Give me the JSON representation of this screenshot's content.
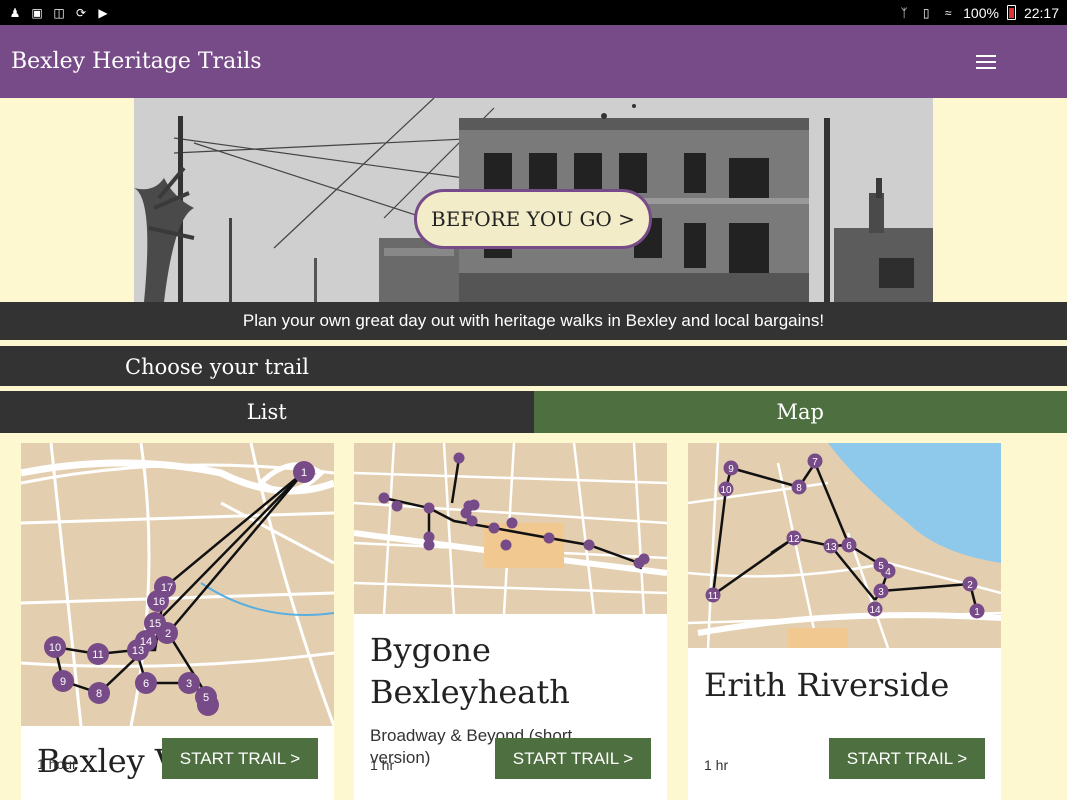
{
  "statusbar": {
    "battery": "100%",
    "time": "22:17",
    "left_icons": [
      "person-icon",
      "image-icon",
      "sd-card-icon",
      "sync-icon",
      "play-store-icon"
    ],
    "right_icons": [
      "bluetooth-icon",
      "vibrate-icon",
      "wifi-icon",
      "battery-icon"
    ]
  },
  "appbar": {
    "title": "Bexley Heritage Trails",
    "menu_icon": "hamburger-menu-icon"
  },
  "hero": {
    "button_label": "BEFORE YOU GO >"
  },
  "tagline": "Plan your own great day out with heritage walks in Bexley and local bargains!",
  "section": {
    "title": "Choose your trail"
  },
  "tabs": [
    {
      "label": "List"
    },
    {
      "label": "Map"
    }
  ],
  "trails": [
    {
      "title": "Bexley Village",
      "subtitle": "",
      "duration": "1 hour",
      "button": "START TRAIL >"
    },
    {
      "title": "Bygone Bexleyheath",
      "subtitle": "Broadway & Beyond (short version)",
      "duration": "1 hr",
      "button": "START TRAIL >"
    },
    {
      "title": "Erith Riverside",
      "subtitle": "",
      "duration": "1 hr",
      "button": "START TRAIL >"
    }
  ],
  "colors": {
    "appbar": "#774a88",
    "background": "#fdf8cf",
    "dark_band": "#333333",
    "accent_green": "#4e7040",
    "marker": "#774a88"
  }
}
